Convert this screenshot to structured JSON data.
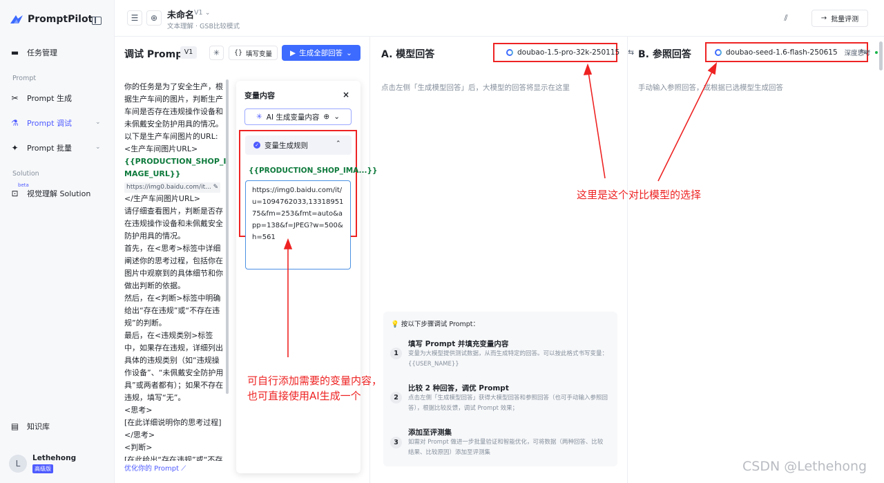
{
  "sidebar": {
    "logo": "PromptPilot",
    "items": [
      {
        "label": "任务管理",
        "icon": "folder-icon"
      },
      {
        "label": "Prompt 生成",
        "icon": "wand-icon"
      },
      {
        "label": "Prompt 调试",
        "icon": "flask-icon"
      },
      {
        "label": "Prompt 批量",
        "icon": "batch-icon"
      },
      {
        "label": "视觉理解 Solution",
        "icon": "solution-icon"
      },
      {
        "label": "知识库",
        "icon": "book-icon"
      }
    ],
    "section_prompt": "Prompt",
    "section_solution": "Solution",
    "beta": "beta",
    "user": {
      "initial": "L",
      "name": "Lethehong",
      "badge": "高级版"
    }
  },
  "header": {
    "title": "未命名",
    "version": "V1",
    "subtitle": "文本理解 · GSB比较模式",
    "batch_eval": "批量评测"
  },
  "debug": {
    "title": "调试 Prompt",
    "version": "V1",
    "fill_vars": "填写变量",
    "gen_all": "生成全部回答",
    "prompt_lines": [
      "你的任务是为了安全生产，根据生产车间的图片，判断生产车间是否存在违规操作设备和未佩戴安全防护用具的情况。",
      "以下是生产车间图片的URL:",
      "<生产车间图片URL>"
    ],
    "prompt_var": "{{PRODUCTION_SHOP_IMAGE_URL}}",
    "prompt_url_preview": "https://img0.baidu.com/it...",
    "prompt_rest": "</生产车间图片URL>\n请仔细查看图片，判断是否存在违规操作设备和未佩戴安全防护用具的情况。\n首先，在<思考>标签中详细阐述你的思考过程，包括你在图片中观察到的具体细节和你做出判断的依据。\n然后，在<判断>标签中明确给出“存在违规”或“不存在违规”的判断。\n最后，在<违规类别>标签中，如果存在违规，详细列出具体的违规类别（如“违规操作设备”、“未佩戴安全防护用具”或两者都有）；如果不存在违规，填写“无”。\n<思考>\n[在此详细说明你的思考过程]\n</思考>\n<判断>\n[在此给出“存在违规”或“不存在",
    "optimize": "优化你的 Prompt"
  },
  "var_panel": {
    "title": "变量内容",
    "ai_gen": "AI 生成变量内容",
    "rule_title": "变量生成规则",
    "var_name": "{{PRODUCTION_SHOP_IMA...}}",
    "var_value": "https://img0.baidu.com/it/u=1094762033,1331895175&fm=253&fmt=auto&app=138&f=JPEG?w=500&h=561"
  },
  "col_a": {
    "title": "A. 模型回答",
    "model": "doubao-1.5-pro-32k-250115",
    "hint": "点击左侧「生成模型回答」后，大模型的回答将显示在这里"
  },
  "col_b": {
    "title": "B. 参照回答",
    "model": "doubao-seed-1.6-flash-250615",
    "thinking": "深度思考",
    "hint": "手动输入参照回答，或根据已选模型生成回答"
  },
  "steps": {
    "heading": "按以下步骤调试 Prompt：",
    "items": [
      {
        "num": "1",
        "title": "填写 Prompt 并填充变量内容",
        "desc": "变量为大模型提供测试数据，从而生成特定的回答。可以按此格式书写变量：{{USER_NAME}}"
      },
      {
        "num": "2",
        "title": "比较 2 种回答，调优 Prompt",
        "desc": "点击左侧「生成模型回答」获得大模型回答和参照回答（也可手动输入参照回答），根据比较反馈，调试 Prompt 效果；"
      },
      {
        "num": "3",
        "title": "添加至评测集",
        "desc": "如需对 Prompt 做进一步批量验证和智能优化，可将数据（两种回答、比较结果、比较原因）添加至评测集"
      }
    ]
  },
  "annotations": {
    "model_choice": "这里是这个对比模型的选择",
    "var_note_1": "可自行添加需要的变量内容，",
    "var_note_2": "也可直接使用AI生成一个"
  },
  "watermark": "CSDN @Lethehong",
  "colors": {
    "accent": "#3d6bff",
    "annotation": "#ee2222",
    "variable": "#0e7a3c"
  }
}
